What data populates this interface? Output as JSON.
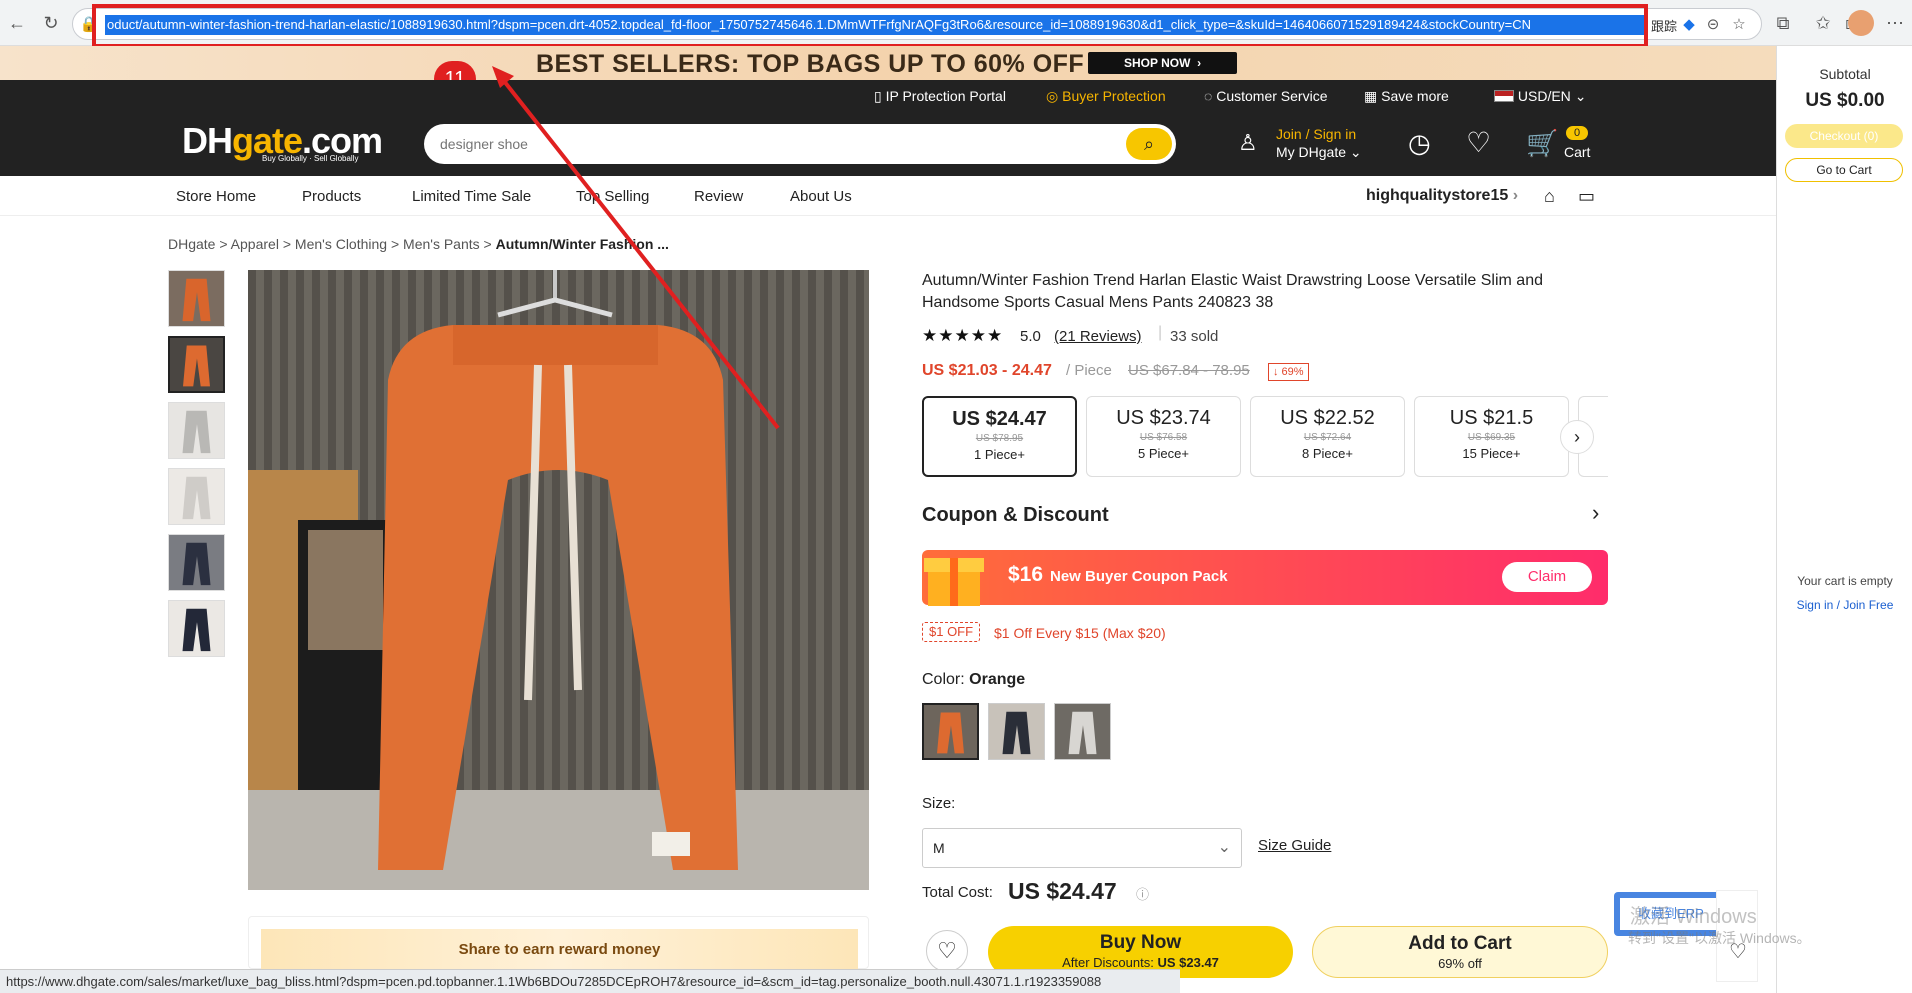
{
  "browser": {
    "url": "oduct/autumn-winter-fashion-trend-harlan-elastic/1088919630.html?dspm=pcen.drt-4052.topdeal_fd-floor_1750752745646.1.DMmWTFrfgNrAQFg3tRo6&resource_id=1088919630&d1_click_type=&skuId=1464066071529189424&stockCountry=CN",
    "toolbar_label": "跟踪",
    "annotation_number": "11"
  },
  "promo": {
    "text": "BEST SELLERS: TOP BAGS UP TO 60% OFF",
    "button": "SHOP NOW",
    "button_arrow": "›"
  },
  "util_bar": {
    "ip_portal": "IP Protection Portal",
    "buyer_protection": "Buyer Protection",
    "customer_service": "Customer Service",
    "save_more": "Save more",
    "currency": "USD/EN"
  },
  "header": {
    "logo_dh": "DH",
    "logo_gate": "gate",
    "logo_com": ".com",
    "logo_tagline": "Buy Globally · Sell Globally",
    "search_placeholder": "designer shoe",
    "join_sign": "Join / Sign in",
    "my_dhgate": "My DHgate",
    "cart_count": "0",
    "cart_label": "Cart"
  },
  "store_nav": {
    "tabs": [
      "Store Home",
      "Products",
      "Limited Time Sale",
      "Top Selling",
      "Review",
      "About Us"
    ],
    "store_name": "highqualitystore15"
  },
  "breadcrumb": {
    "items": [
      "DHgate",
      "Apparel",
      "Men's Clothing",
      "Men's Pants"
    ],
    "current": "Autumn/Winter Fashion ...",
    "sep": ">"
  },
  "product": {
    "title": "Autumn/Winter Fashion Trend Harlan Elastic Waist Drawstring Loose Versatile Slim and Handsome Sports Casual Mens Pants 240823 38",
    "rating": "5.0",
    "reviews": "(21 Reviews)",
    "sold": "33 sold",
    "price_range": "US $21.03 - 24.47",
    "per_piece": "/ Piece",
    "orig_range": "US $67.84 - 78.95",
    "discount": "↓ 69%",
    "tiers": [
      {
        "price": "US $24.47",
        "orig": "US $78.95",
        "qty": "1 Piece+"
      },
      {
        "price": "US $23.74",
        "orig": "US $76.58",
        "qty": "5 Piece+"
      },
      {
        "price": "US $22.52",
        "orig": "US $72.64",
        "qty": "8 Piece+"
      },
      {
        "price": "US $21.5",
        "orig": "US $69.35",
        "qty": "15 Piece+"
      }
    ],
    "coupon_heading": "Coupon & Discount",
    "coupon_amount": "$16",
    "coupon_text": "New Buyer Coupon Pack",
    "claim": "Claim",
    "off_badge": "$1 OFF",
    "off_text": "$1 Off Every $15  (Max $20)",
    "color_label": "Color:",
    "color_value": "Orange",
    "size_label": "Size:",
    "size_value": "M",
    "size_guide": "Size Guide",
    "total_label": "Total Cost:",
    "total_value": "US $24.47",
    "buy_now": "Buy Now",
    "after_discounts": "After Discounts:",
    "after_value": "US $23.47",
    "add_to_cart": "Add to Cart",
    "add_cart_sub": "69% off",
    "share_text": "Share to earn reward money"
  },
  "cart_panel": {
    "subtotal_label": "Subtotal",
    "subtotal": "US $0.00",
    "checkout": "Checkout (0)",
    "go_to_cart": "Go to Cart",
    "empty": "Your cart is empty",
    "sign_in": "Sign in",
    "slash": "/",
    "join_free": "Join Free"
  },
  "erp": {
    "label": "收藏到ERP",
    "close": "✕"
  },
  "activate": "转到\"设置\"以激活 Windows。",
  "activate_title": "激活 Windows",
  "status_bar": "https://www.dhgate.com/sales/market/luxe_bag_bliss.html?dspm=pcen.pd.topbanner.1.1Wb6BDOu7285DCEpROH7&resource_id=&scm_id=tag.personalize_booth.null.43071.1.r1923359088",
  "colors": {
    "accent_red": "#e02020",
    "brand_yellow": "#f7c600",
    "price_red": "#e0452b"
  }
}
